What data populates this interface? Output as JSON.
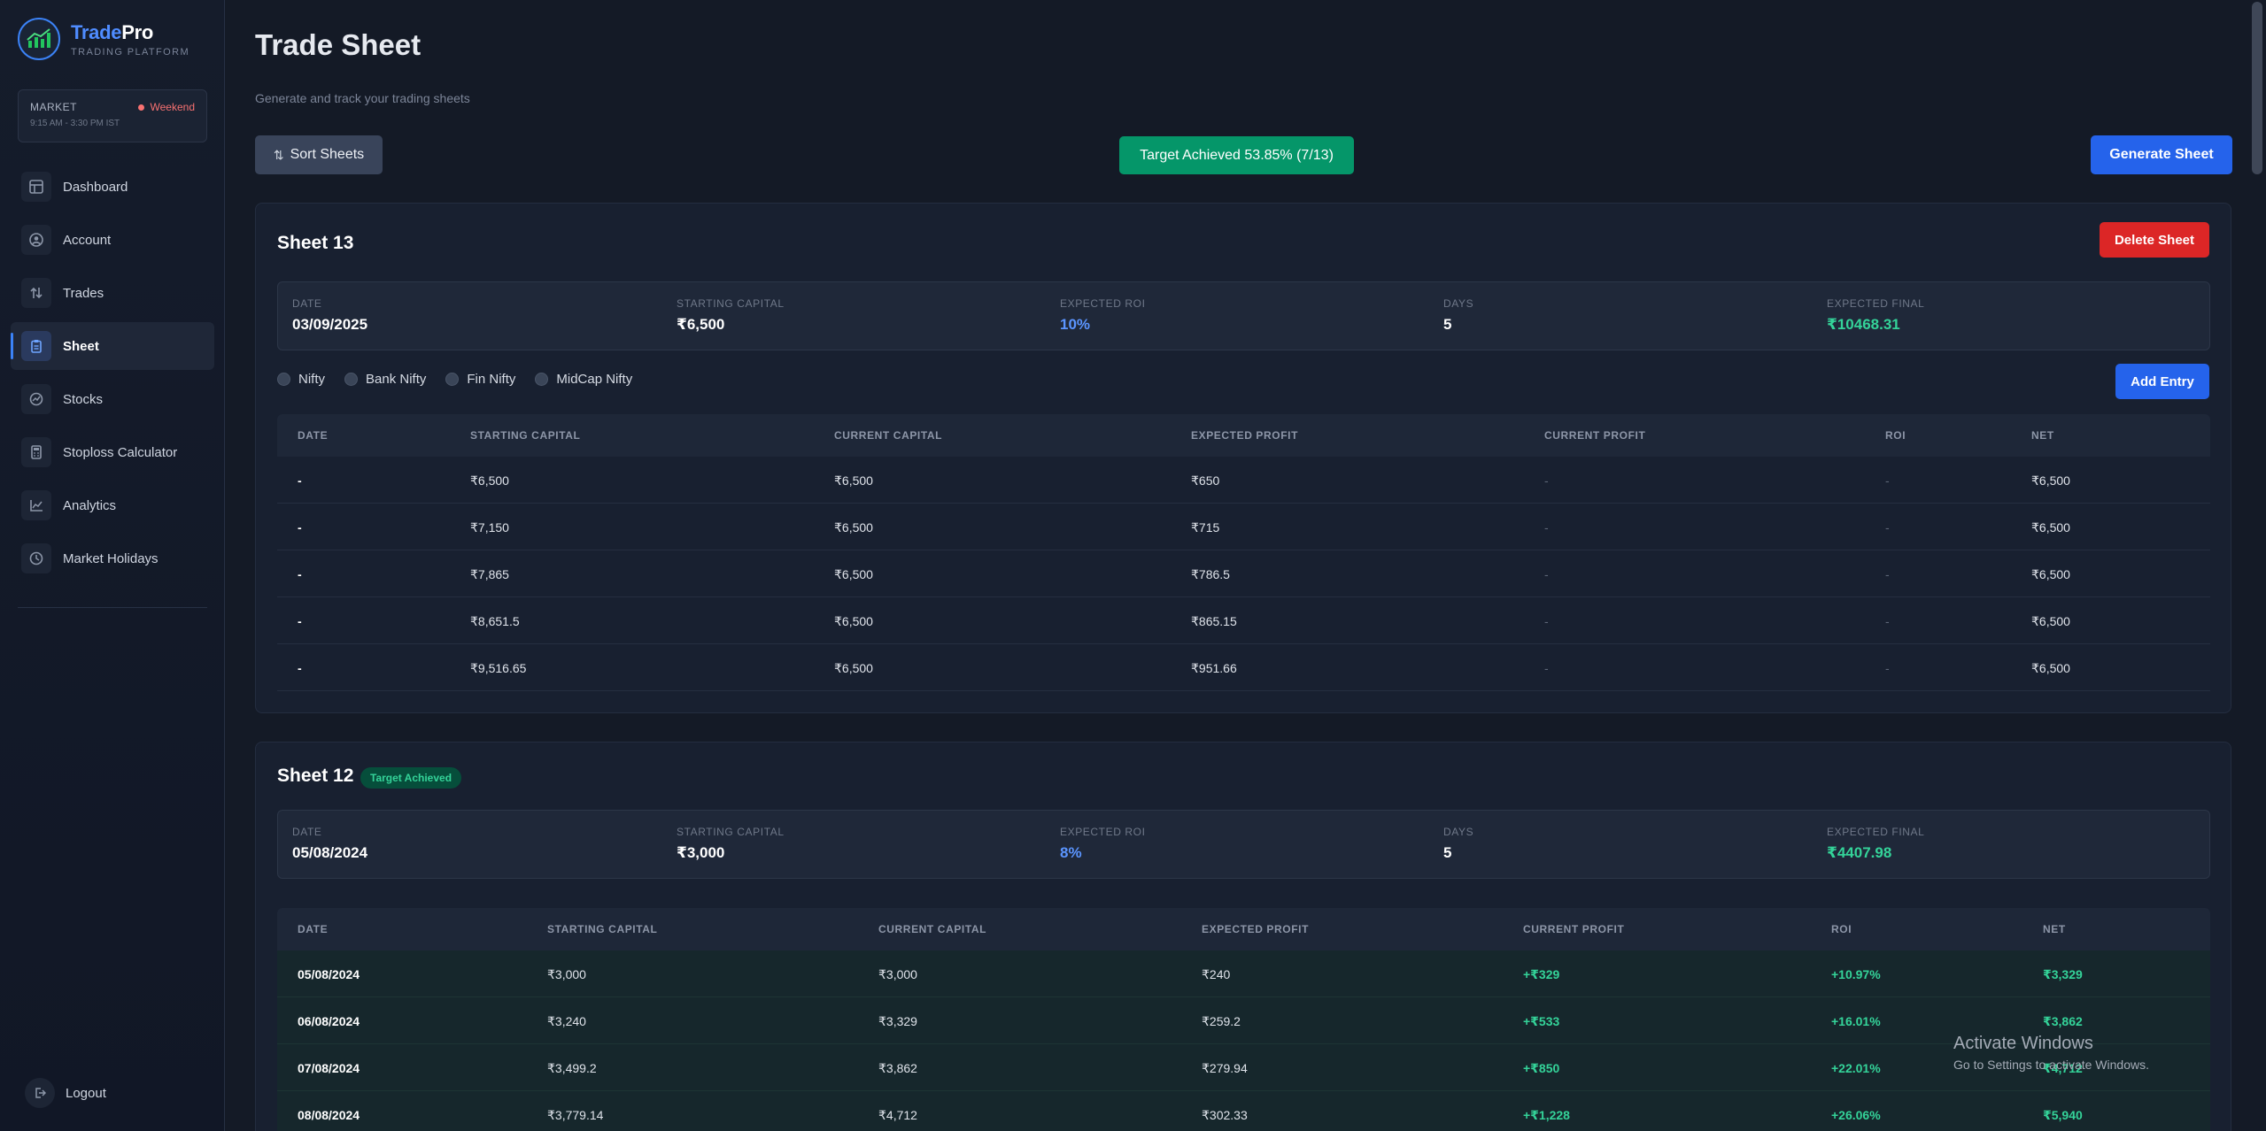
{
  "brand": {
    "name_prefix": "Trade",
    "name_accent": "Pro",
    "subtitle": "TRADING PLATFORM"
  },
  "market": {
    "label": "MARKET",
    "status": "Weekend",
    "hours": "9:15 AM - 3:30 PM IST",
    "status_color": "#f87171"
  },
  "nav": {
    "items": [
      {
        "label": "Dashboard",
        "icon": "dashboard-icon",
        "active": false
      },
      {
        "label": "Account",
        "icon": "user-icon",
        "active": false
      },
      {
        "label": "Trades",
        "icon": "swap-arrows-icon",
        "active": false
      },
      {
        "label": "Sheet",
        "icon": "clipboard-icon",
        "active": true
      },
      {
        "label": "Stocks",
        "icon": "stocks-icon",
        "active": false
      },
      {
        "label": "Stoploss Calculator",
        "icon": "calculator-icon",
        "active": false
      },
      {
        "label": "Analytics",
        "icon": "chart-line-icon",
        "active": false
      },
      {
        "label": "Market Holidays",
        "icon": "calendar-icon",
        "active": false
      }
    ],
    "logout": "Logout"
  },
  "page": {
    "title": "Trade Sheet",
    "subtitle": "Generate and track your trading sheets",
    "sort_label": "Sort Sheets",
    "target_label": "Target Achieved 53.85% (7/13)",
    "generate_label": "Generate Sheet"
  },
  "sheet13": {
    "title": "Sheet 13",
    "delete_label": "Delete Sheet",
    "summary": {
      "date_label": "DATE",
      "date": "03/09/2025",
      "capital_label": "STARTING CAPITAL",
      "capital": "₹6,500",
      "roi_label": "EXPECTED ROI",
      "roi": "10%",
      "days_label": "DAYS",
      "days": "5",
      "final_label": "EXPECTED FINAL",
      "final": "₹10468.31"
    },
    "indices": [
      "Nifty",
      "Bank Nifty",
      "Fin Nifty",
      "MidCap Nifty"
    ],
    "add_label": "Add Entry",
    "headers": [
      "DATE",
      "STARTING CAPITAL",
      "CURRENT CAPITAL",
      "EXPECTED PROFIT",
      "CURRENT PROFIT",
      "ROI",
      "NET"
    ],
    "rows": [
      [
        "-",
        "₹6,500",
        "₹6,500",
        "₹650",
        "-",
        "-",
        "₹6,500"
      ],
      [
        "-",
        "₹7,150",
        "₹6,500",
        "₹715",
        "-",
        "-",
        "₹6,500"
      ],
      [
        "-",
        "₹7,865",
        "₹6,500",
        "₹786.5",
        "-",
        "-",
        "₹6,500"
      ],
      [
        "-",
        "₹8,651.5",
        "₹6,500",
        "₹865.15",
        "-",
        "-",
        "₹6,500"
      ],
      [
        "-",
        "₹9,516.65",
        "₹6,500",
        "₹951.66",
        "-",
        "-",
        "₹6,500"
      ]
    ]
  },
  "sheet12": {
    "title": "Sheet 12",
    "badge": "Target Achieved",
    "summary": {
      "date_label": "DATE",
      "date": "05/08/2024",
      "capital_label": "STARTING CAPITAL",
      "capital": "₹3,000",
      "roi_label": "EXPECTED ROI",
      "roi": "8%",
      "days_label": "DAYS",
      "days": "5",
      "final_label": "EXPECTED FINAL",
      "final": "₹4407.98"
    },
    "headers": [
      "DATE",
      "STARTING CAPITAL",
      "CURRENT CAPITAL",
      "EXPECTED PROFIT",
      "CURRENT PROFIT",
      "ROI",
      "NET"
    ],
    "rows": [
      [
        "05/08/2024",
        "₹3,000",
        "₹3,000",
        "₹240",
        "+₹329",
        "+10.97%",
        "₹3,329"
      ],
      [
        "06/08/2024",
        "₹3,240",
        "₹3,329",
        "₹259.2",
        "+₹533",
        "+16.01%",
        "₹3,862"
      ],
      [
        "07/08/2024",
        "₹3,499.2",
        "₹3,862",
        "₹279.94",
        "+₹850",
        "+22.01%",
        "₹4,712"
      ],
      [
        "08/08/2024",
        "₹3,779.14",
        "₹4,712",
        "₹302.33",
        "+₹1,228",
        "+26.06%",
        "₹5,940"
      ]
    ]
  },
  "watermark": {
    "title": "Activate Windows",
    "subtitle": "Go to Settings to activate Windows."
  },
  "colors": {
    "accent": "#2563eb",
    "success": "#059669",
    "danger": "#dc2626",
    "positive_text": "#34d399"
  }
}
